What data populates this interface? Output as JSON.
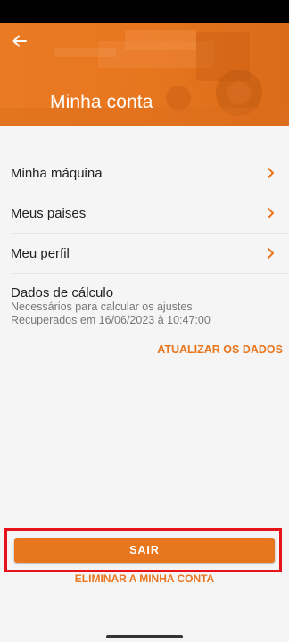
{
  "header": {
    "title": "Minha conta",
    "back_icon": "arrow-left-icon",
    "color": "#e8761f"
  },
  "menu": {
    "items": [
      {
        "label": "Minha máquina",
        "icon": "chevron-right-icon"
      },
      {
        "label": "Meus paises",
        "icon": "chevron-right-icon"
      },
      {
        "label": "Meu perfil",
        "icon": "chevron-right-icon"
      }
    ]
  },
  "calc": {
    "title": "Dados de cálculo",
    "subtitle": "Necessários para calcular os ajustes",
    "recovered": "Recuperados em 16/06/2023 à 10:47:00",
    "update_label": "ATUALIZAR OS DADOS"
  },
  "actions": {
    "logout_label": "SAIR",
    "delete_label": "ELIMINAR A MINHA CONTA"
  },
  "colors": {
    "accent": "#e8761f",
    "highlight": "#e8121a"
  }
}
